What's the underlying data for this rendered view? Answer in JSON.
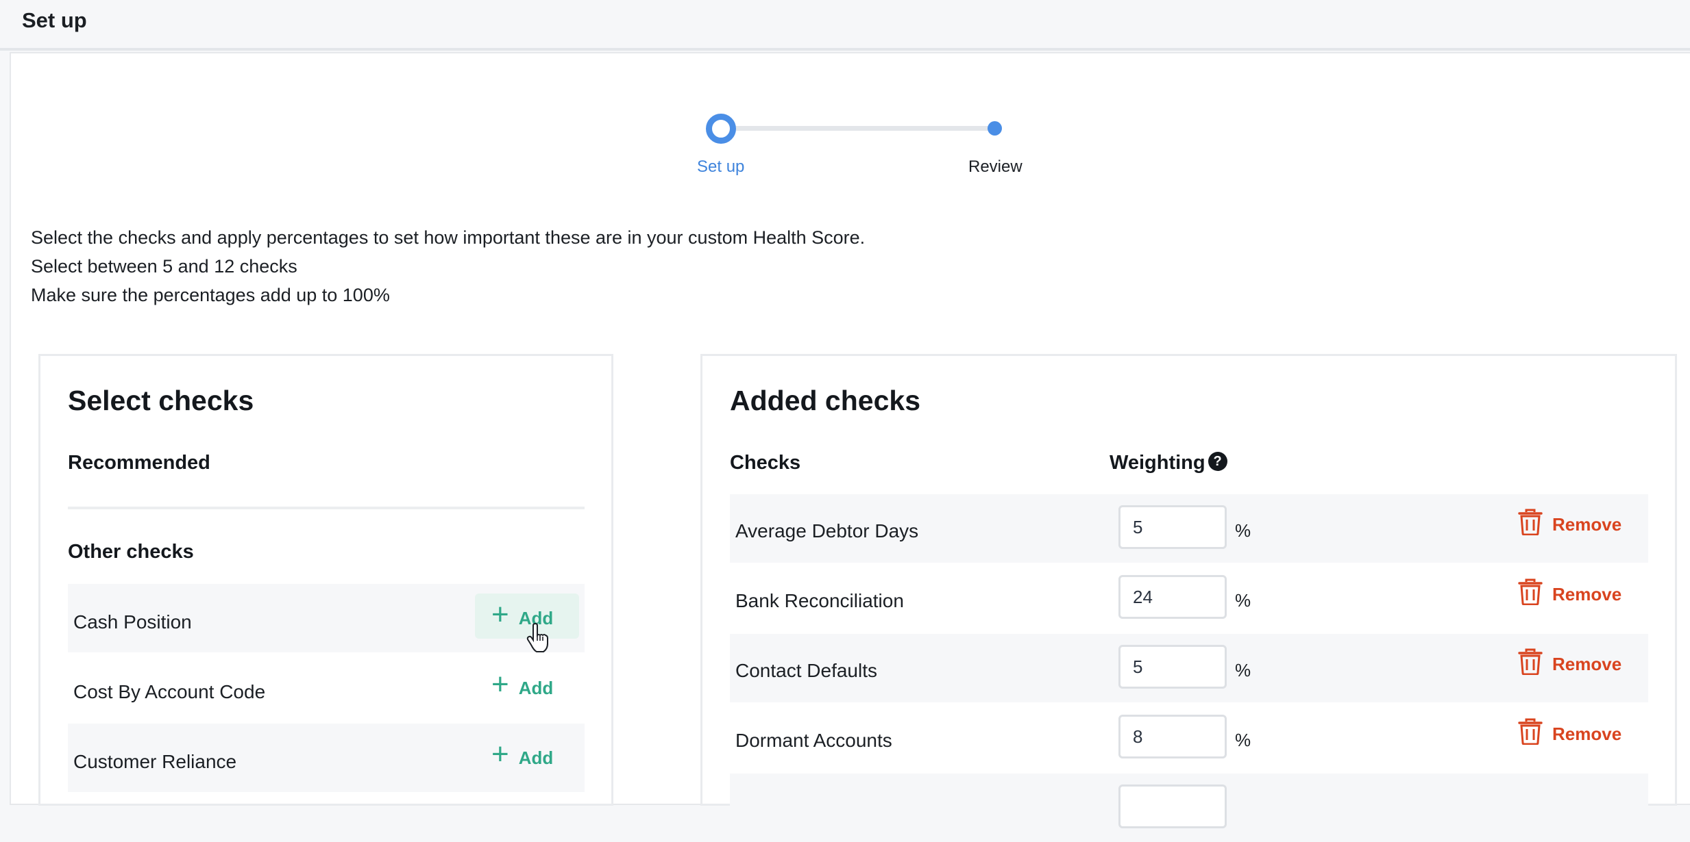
{
  "header": {
    "title": "Set up"
  },
  "stepper": {
    "steps": [
      {
        "label": "Set up",
        "active": true
      },
      {
        "label": "Review",
        "active": false
      }
    ]
  },
  "intro": {
    "lines": [
      "Select the checks and apply percentages to set how important these are in your custom Health Score.",
      "Select between 5 and 12 checks",
      "Make sure the percentages add up to 100%"
    ]
  },
  "select_checks": {
    "title": "Select checks",
    "recommended_heading": "Recommended",
    "other_heading": "Other checks",
    "add_label": "Add",
    "items": [
      {
        "label": "Cash Position"
      },
      {
        "label": "Cost By Account Code"
      },
      {
        "label": "Customer Reliance"
      }
    ]
  },
  "added_checks": {
    "title": "Added checks",
    "col_checks": "Checks",
    "col_weighting": "Weighting",
    "help_icon": "?",
    "percent_sign": "%",
    "remove_label": "Remove",
    "items": [
      {
        "label": "Average Debtor Days",
        "value": "5"
      },
      {
        "label": "Bank Reconciliation",
        "value": "24"
      },
      {
        "label": "Contact Defaults",
        "value": "5"
      },
      {
        "label": "Dormant Accounts",
        "value": "8"
      }
    ]
  },
  "colors": {
    "accent_blue": "#4a8ee6",
    "add_green": "#2fa888",
    "remove_red": "#d9441f"
  }
}
